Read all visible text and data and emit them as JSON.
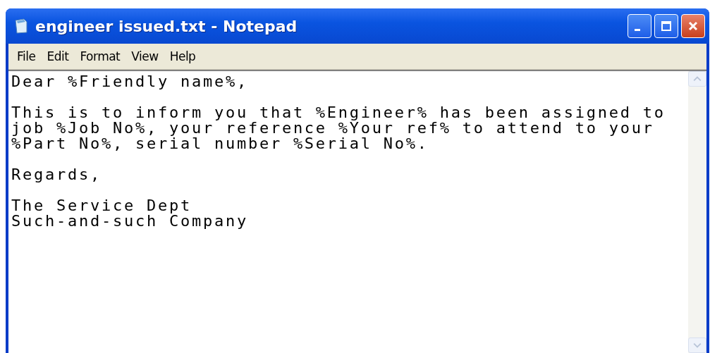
{
  "window": {
    "title": "engineer issued.txt - Notepad"
  },
  "menu": [
    {
      "label": "File"
    },
    {
      "label": "Edit"
    },
    {
      "label": "Format"
    },
    {
      "label": "View"
    },
    {
      "label": "Help"
    }
  ],
  "document": {
    "paragraphs": [
      {
        "lines": [
          "Dear %Friendly name%,"
        ]
      },
      {
        "lines": [
          "This is to inform you that %Engineer% has been assigned to",
          "job %Job No%, your reference %Your ref% to attend to your",
          "%Part No%, serial number %Serial No%."
        ]
      },
      {
        "lines": [
          "Regards,"
        ]
      },
      {
        "lines": [
          "The Service Dept",
          "Such-and-such Company"
        ]
      }
    ]
  }
}
